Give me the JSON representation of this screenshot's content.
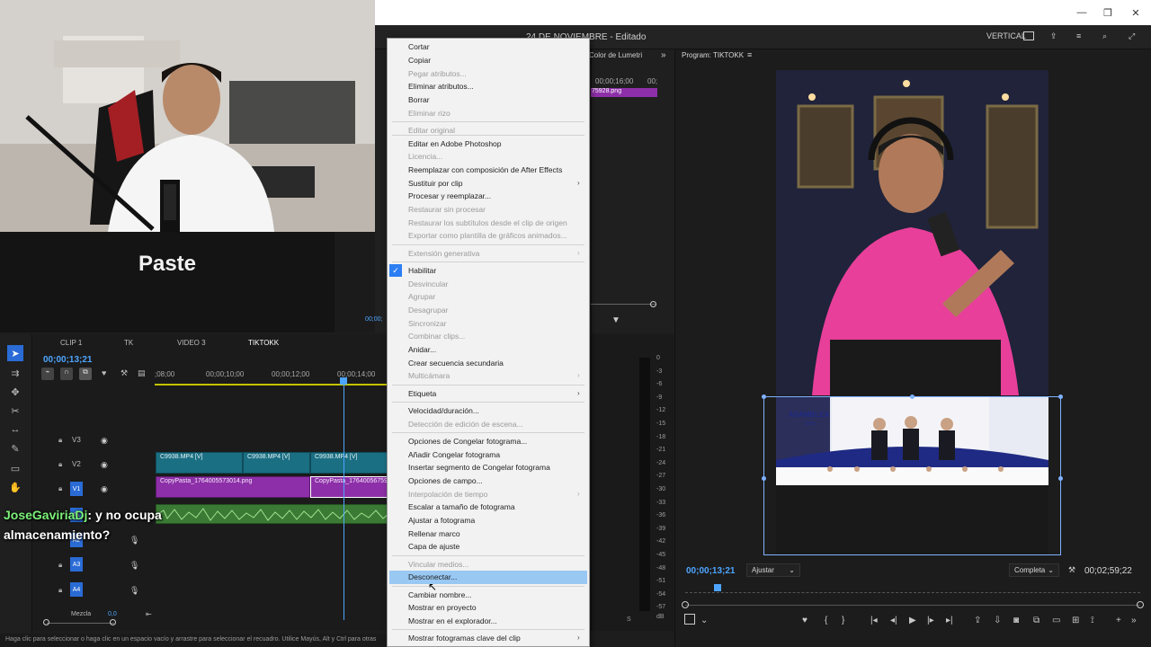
{
  "window": {
    "title": "24 DE NOVIEMBRE - Editado",
    "controls": [
      "—",
      "❐",
      "✕"
    ]
  },
  "header": {
    "vertical_label": "VERTICAL"
  },
  "overlay": {
    "caption": "Paste",
    "chat_user": "JoseGaviriaDj",
    "chat_text_1": ": y no ocupa",
    "chat_text_2": "almacenamiento?"
  },
  "panels": {
    "lumetri_tab": "Color de Lumetri",
    "ruler_1": "00;00;16;00",
    "ruler_2": "00;",
    "clip_name": "75928.png",
    "small_text": "00;00;"
  },
  "timeline": {
    "tabs": [
      "CLIP 1",
      "TK",
      "VIDEO 3",
      "TIKTOKK"
    ],
    "timecode": "00;00;13;21",
    "ruler": [
      ";08;00",
      "00;00;10;00",
      "00;00;12;00",
      "00;00;14;00"
    ],
    "tracks": [
      "V3",
      "V2",
      "V1",
      "A1",
      "A2",
      "A3",
      "A4"
    ],
    "clips_v2": [
      "C9938.MP4 [V]",
      "C9938.MP4 [V]",
      "C9938.MP4 [V]"
    ],
    "clips_v1": [
      "CopyPasta_1764005573014.png",
      "CopyPasta_1764005675928.png"
    ],
    "mix_label": "Mezcla",
    "mix_value": "0,0",
    "status": "Haga clic para seleccionar o haga clic en un espacio vacío y arrastre para seleccionar el recuadro. Utilice Mayús, Alt y Ctrl para otras"
  },
  "meter": {
    "db": [
      "0",
      "-3",
      "-6",
      "-9",
      "-12",
      "-15",
      "-18",
      "-21",
      "-24",
      "-27",
      "-30",
      "-33",
      "-36",
      "-39",
      "-42",
      "-45",
      "-48",
      "-51",
      "-54",
      "-57",
      "dB"
    ],
    "s_label": "S"
  },
  "program": {
    "title": "Program: TIKTOKK",
    "timecode": "00;00;13;21",
    "fit": "Ajustar",
    "quality": "Completa",
    "duration": "00;02;59;22",
    "sign_text": "ASAMBLEA",
    "sign_year": "2025"
  },
  "menu": {
    "items": [
      {
        "label": "Cortar",
        "enabled": true
      },
      {
        "label": "Copiar",
        "enabled": true
      },
      {
        "label": "Pegar atributos...",
        "enabled": false
      },
      {
        "label": "Eliminar atributos...",
        "enabled": true
      },
      {
        "label": "Borrar",
        "enabled": true
      },
      {
        "label": "Eliminar rizo",
        "enabled": false
      },
      {
        "label": "Editar original",
        "enabled": false
      },
      {
        "label": "Editar en Adobe Photoshop",
        "enabled": true
      },
      {
        "label": "Licencia...",
        "enabled": false
      },
      {
        "label": "Reemplazar con composición de After Effects",
        "enabled": true
      },
      {
        "label": "Sustituir por clip",
        "enabled": true
      },
      {
        "label": "Procesar y reemplazar...",
        "enabled": true
      },
      {
        "label": "Restaurar sin procesar",
        "enabled": false
      },
      {
        "label": "Restaurar los subtítulos desde el clip de origen",
        "enabled": false
      },
      {
        "label": "Exportar como plantilla de gráficos animados...",
        "enabled": false
      },
      {
        "label": "Extensión generativa",
        "enabled": false
      },
      {
        "label": "Habilitar",
        "enabled": true
      },
      {
        "label": "Desvincular",
        "enabled": false
      },
      {
        "label": "Agrupar",
        "enabled": false
      },
      {
        "label": "Desagrupar",
        "enabled": false
      },
      {
        "label": "Sincronizar",
        "enabled": false
      },
      {
        "label": "Combinar clips...",
        "enabled": false
      },
      {
        "label": "Anidar...",
        "enabled": true
      },
      {
        "label": "Crear secuencia secundaria",
        "enabled": true
      },
      {
        "label": "Multicámara",
        "enabled": false
      },
      {
        "label": "Etiqueta",
        "enabled": true
      },
      {
        "label": "Velocidad/duración...",
        "enabled": true
      },
      {
        "label": "Detección de edición de escena...",
        "enabled": false
      },
      {
        "label": "Opciones de Congelar fotograma...",
        "enabled": true
      },
      {
        "label": "Añadir Congelar fotograma",
        "enabled": true
      },
      {
        "label": "Insertar segmento de Congelar fotograma",
        "enabled": true
      },
      {
        "label": "Opciones de campo...",
        "enabled": true
      },
      {
        "label": "Interpolación de tiempo",
        "enabled": false
      },
      {
        "label": "Escalar a tamaño de fotograma",
        "enabled": true
      },
      {
        "label": "Ajustar a fotograma",
        "enabled": true
      },
      {
        "label": "Rellenar marco",
        "enabled": true
      },
      {
        "label": "Capa de ajuste",
        "enabled": true
      },
      {
        "label": "Vincular medios...",
        "enabled": false
      },
      {
        "label": "Desconectar...",
        "enabled": true
      },
      {
        "label": "Cambiar nombre...",
        "enabled": true
      },
      {
        "label": "Mostrar en proyecto",
        "enabled": true
      },
      {
        "label": "Mostrar en el explorador...",
        "enabled": true
      },
      {
        "label": "Mostrar fotogramas clave del clip",
        "enabled": true
      }
    ]
  }
}
